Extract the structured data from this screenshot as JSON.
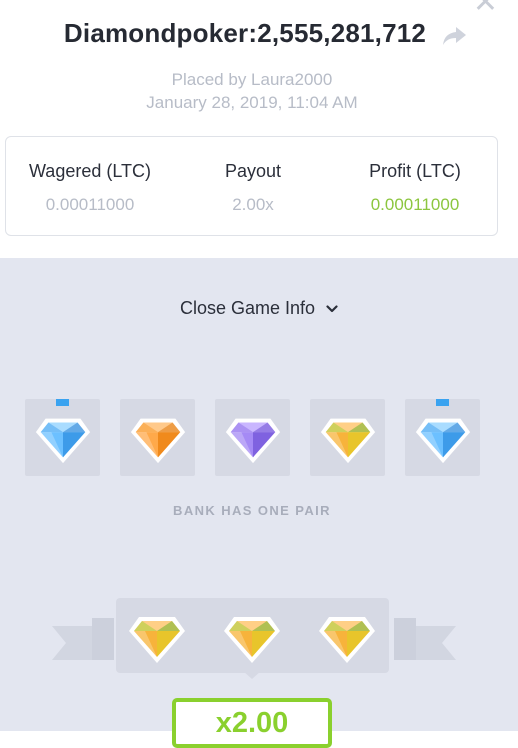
{
  "header": {
    "title": "Diamondpoker:2,555,281,712",
    "placed_by": "Placed by Laura2000",
    "date": "January 28, 2019, 11:04 AM",
    "close_icon": "close-icon",
    "share_icon": "share-icon"
  },
  "stats": [
    {
      "label": "Wagered (LTC)",
      "value": "0.00011000"
    },
    {
      "label": "Payout",
      "value": "2.00x"
    },
    {
      "label": "Profit (LTC)",
      "value": "0.00011000",
      "color": "#8cc63f"
    }
  ],
  "game": {
    "toggle_label": "Close Game Info",
    "bank_cards": [
      {
        "gem": "blue",
        "marked": true
      },
      {
        "gem": "orange",
        "marked": false
      },
      {
        "gem": "purple",
        "marked": false
      },
      {
        "gem": "yellow-green",
        "marked": false
      },
      {
        "gem": "blue",
        "marked": true
      }
    ],
    "bank_result": "BANK HAS ONE PAIR",
    "player_hand": [
      "yellow-green",
      "yellow-green",
      "yellow-green"
    ],
    "multiplier": "x2.00"
  },
  "colors": {
    "accent_green": "#8ad02e",
    "panel_bg": "#e3e6f0",
    "marker_blue": "#3aa3f0"
  }
}
